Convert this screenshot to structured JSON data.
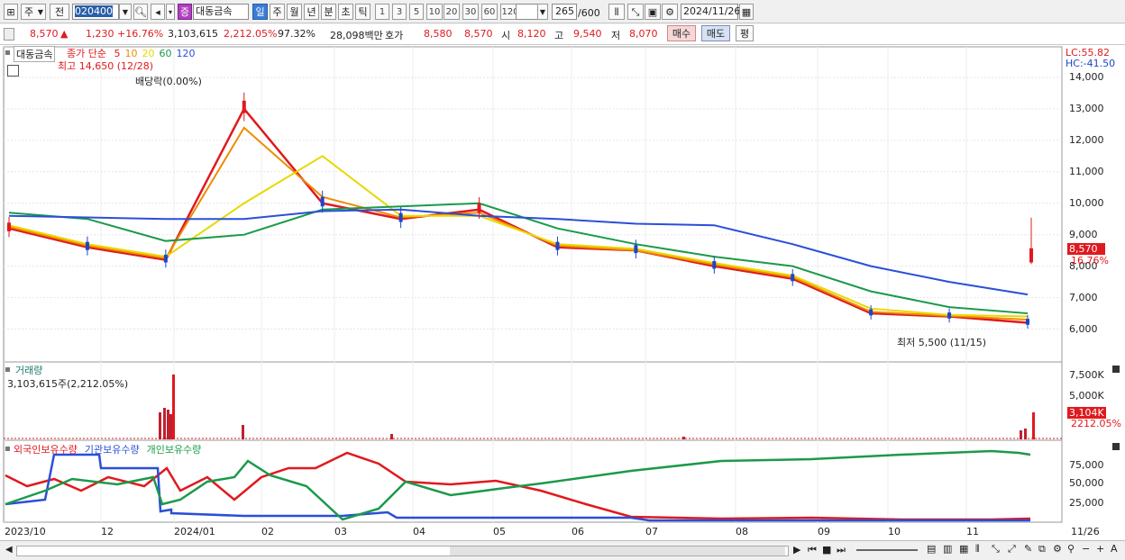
{
  "toolbar": {
    "period_select": "주",
    "period_select2": "전",
    "stock_code": "020400",
    "stock_badge": "증",
    "stock_name": "대동금속",
    "periods": [
      "일",
      "주",
      "월",
      "년",
      "분",
      "초",
      "틱"
    ],
    "active_period": "일",
    "intervals": [
      "1",
      "3",
      "5",
      "10",
      "20",
      "30",
      "60",
      "120"
    ],
    "count_display": "265",
    "count_max": "/600",
    "date": "2024/11/26"
  },
  "quote": {
    "price": "8,570",
    "arrow": "▲",
    "change": "1,230",
    "change_pct": "+16.76%",
    "volume": "3,103,615",
    "vol_ratio": "2,212.05%",
    "vol_power": "97.32%",
    "trade_amount": "28,098백만",
    "hoga_label": "호가",
    "ask": "8,580",
    "bid": "8,570",
    "open_label": "시",
    "open": "8,120",
    "high_label": "고",
    "high": "9,540",
    "low_label": "저",
    "low": "8,070",
    "buy_btn": "매수",
    "sell_btn": "매도",
    "eval_btn": "평"
  },
  "price_panel": {
    "name_label": "대동금속",
    "legend_title": "종가 단순",
    "ma": [
      {
        "label": "5",
        "color": "#e0191e"
      },
      {
        "label": "10",
        "color": "#f08a00"
      },
      {
        "label": "20",
        "color": "#e8d800"
      },
      {
        "label": "60",
        "color": "#1a9a4a"
      },
      {
        "label": "120",
        "color": "#2a4fd8"
      }
    ],
    "lc": "LC:55.82",
    "hc": "HC:-41.50",
    "high_annot": "최고 14,650 (12/28)",
    "dividend_annot": "배당락(0.00%)",
    "low_annot": "최저 5,500 (11/15)",
    "yticks": [
      "14,000",
      "13,000",
      "12,000",
      "11,000",
      "10,000",
      "9,000",
      "8,000",
      "7,000",
      "6,000"
    ],
    "cur_price_tag": "8,570",
    "cur_pct_tag": "16.76%"
  },
  "volume_panel": {
    "title": "거래량",
    "value": "3,103,615주(2,212.05%)",
    "yticks": [
      "7,500K",
      "5,000K"
    ],
    "cur_tag": "3,104K",
    "pct_tag": "2212.05%"
  },
  "holding_panel": {
    "legend": [
      {
        "label": "외국인보유수량",
        "color": "#e0191e"
      },
      {
        "label": "기관보유수량",
        "color": "#2a4fd8"
      },
      {
        "label": "개인보유수량",
        "color": "#1a9a4a"
      }
    ],
    "yticks": [
      "75,000",
      "50,000",
      "25,000"
    ]
  },
  "xaxis": {
    "labels": [
      "2023/10",
      "12",
      "2024/01",
      "02",
      "03",
      "04",
      "05",
      "06",
      "07",
      "08",
      "09",
      "10",
      "11"
    ],
    "end_label": "11/26"
  },
  "chart_data": {
    "type": "line",
    "title": "대동금속",
    "x": [
      "2023/10",
      "11",
      "12",
      "2024/01",
      "02",
      "03",
      "04",
      "05",
      "06",
      "07",
      "08",
      "09",
      "10",
      "11"
    ],
    "series": [
      {
        "name": "5",
        "values": [
          9200,
          8600,
          8200,
          13000,
          10000,
          9500,
          9800,
          8600,
          8500,
          8000,
          7600,
          6500,
          6400,
          6200
        ]
      },
      {
        "name": "10",
        "values": [
          9250,
          8650,
          8250,
          12400,
          10200,
          9550,
          9700,
          8650,
          8500,
          8050,
          7650,
          6550,
          6420,
          6300
        ]
      },
      {
        "name": "20",
        "values": [
          9300,
          8700,
          8300,
          10000,
          11500,
          9600,
          9600,
          8700,
          8550,
          8100,
          7700,
          6650,
          6450,
          6400
        ]
      },
      {
        "name": "60",
        "values": [
          9700,
          9500,
          8800,
          9000,
          9800,
          9900,
          10000,
          9200,
          8700,
          8300,
          8000,
          7200,
          6700,
          6500
        ]
      },
      {
        "name": "120",
        "values": [
          9600,
          9550,
          9500,
          9500,
          9750,
          9800,
          9600,
          9500,
          9350,
          9300,
          8700,
          8000,
          7500,
          7100
        ]
      }
    ],
    "ylim": [
      5300,
      14800
    ]
  }
}
